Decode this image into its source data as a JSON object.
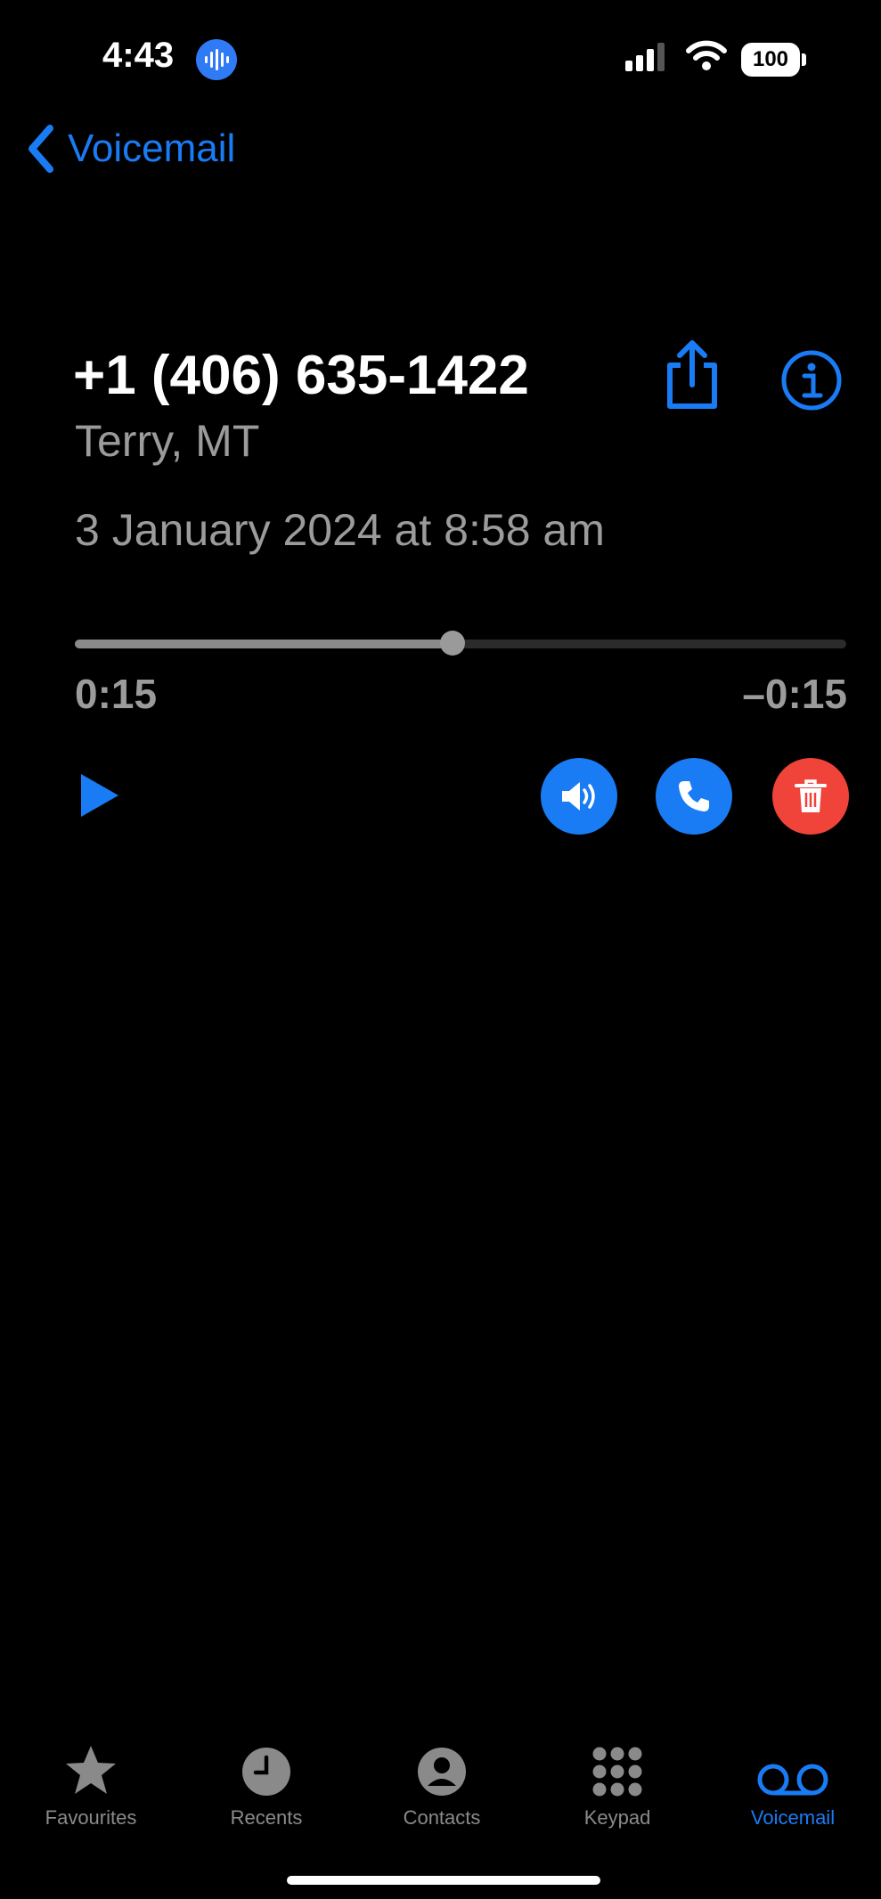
{
  "status_bar": {
    "time": "4:43",
    "battery": "100"
  },
  "nav": {
    "back_label": "Voicemail"
  },
  "voicemail": {
    "phone": "+1 (406) 635-1422",
    "location": "Terry, MT",
    "datetime": "3 January 2024 at 8:58 am",
    "elapsed": "0:15",
    "remaining": "–0:15",
    "progress_fraction": 0.49
  },
  "colors": {
    "accent": "#1a7cf5",
    "delete": "#f0433a",
    "muted": "#9b9b9b"
  },
  "tabs": [
    {
      "label": "Favourites",
      "icon": "star-icon",
      "active": false
    },
    {
      "label": "Recents",
      "icon": "clock-icon",
      "active": false
    },
    {
      "label": "Contacts",
      "icon": "person-circle-icon",
      "active": false
    },
    {
      "label": "Keypad",
      "icon": "keypad-icon",
      "active": false
    },
    {
      "label": "Voicemail",
      "icon": "voicemail-icon",
      "active": true
    }
  ]
}
